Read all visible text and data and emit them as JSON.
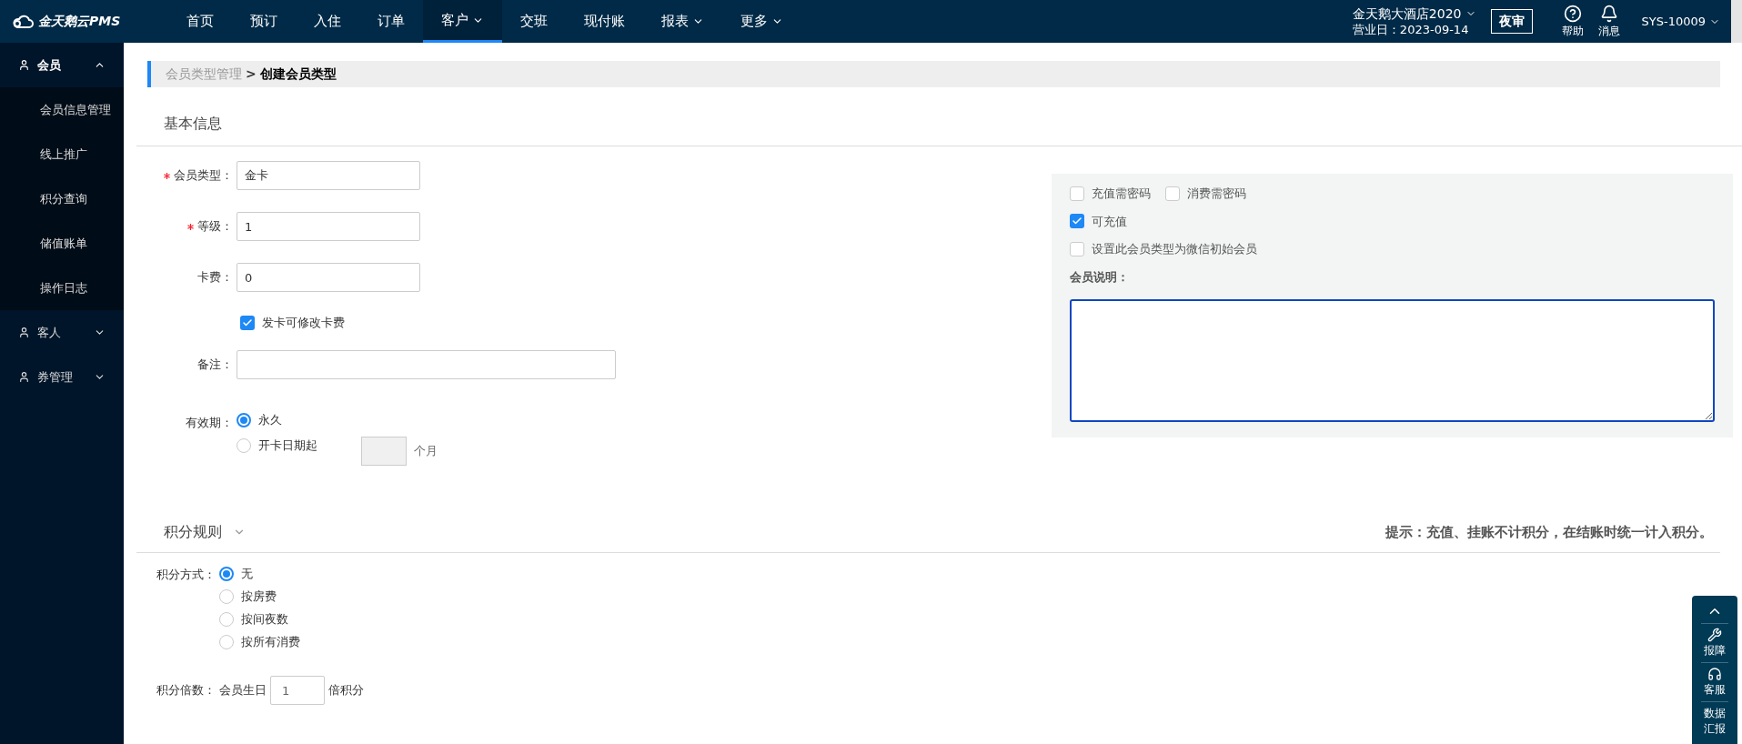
{
  "header": {
    "logo": "金天鹅云PMS",
    "nav": [
      {
        "label": "首页",
        "selected": false,
        "dropdown": false
      },
      {
        "label": "预订",
        "selected": false,
        "dropdown": false
      },
      {
        "label": "入住",
        "selected": false,
        "dropdown": false
      },
      {
        "label": "订单",
        "selected": false,
        "dropdown": false
      },
      {
        "label": "客户",
        "selected": true,
        "dropdown": true
      },
      {
        "label": "交班",
        "selected": false,
        "dropdown": false
      },
      {
        "label": "现付账",
        "selected": false,
        "dropdown": false
      },
      {
        "label": "报表",
        "selected": false,
        "dropdown": true
      },
      {
        "label": "更多",
        "selected": false,
        "dropdown": true
      }
    ],
    "hotel": "金天鹅大酒店2020",
    "business_date": "营业日：2023-09-14",
    "night_audit": "夜审",
    "help": "帮助",
    "messages": "消息",
    "user": "SYS-10009"
  },
  "sidebar": {
    "items": [
      {
        "label": "会员",
        "expanded": true,
        "children": [
          {
            "label": "会员信息管理"
          },
          {
            "label": "线上推广"
          },
          {
            "label": "积分查询"
          },
          {
            "label": "储值账单"
          },
          {
            "label": "操作日志"
          }
        ]
      },
      {
        "label": "客人",
        "expanded": false
      },
      {
        "label": "券管理",
        "expanded": false
      }
    ]
  },
  "breadcrumb": {
    "parent": "会员类型管理",
    "separator": ">",
    "current": "创建会员类型"
  },
  "basic_info": {
    "title": "基本信息",
    "fields": [
      {
        "kind": "input",
        "label": "会员类型：",
        "required": true,
        "value": "金卡"
      },
      {
        "kind": "input",
        "label": "等级：",
        "required": true,
        "value": "1"
      },
      {
        "kind": "input",
        "label": "卡费：",
        "required": false,
        "value": "0"
      },
      {
        "kind": "checkbox",
        "label": "发卡可修改卡费",
        "checked": true
      },
      {
        "kind": "wide_input",
        "label": "备注：",
        "required": false
      }
    ],
    "validity": {
      "label": "有效期：",
      "options": [
        {
          "label": "永久",
          "selected": true
        },
        {
          "label": "开卡日期起",
          "selected": false
        }
      ],
      "unit": "个月"
    },
    "options": [
      [
        {
          "label": "充值需密码",
          "checked": false
        },
        {
          "label": "消费需密码",
          "checked": false
        }
      ],
      [
        {
          "label": "可充值",
          "checked": true
        }
      ],
      [
        {
          "label": "设置此会员类型为微信初始会员",
          "checked": false
        }
      ]
    ],
    "description_label": "会员说明："
  },
  "points": {
    "title": "积分规则",
    "hint": "提示：充值、挂账不计积分，在结账时统一计入积分。",
    "method_label": "积分方式：",
    "methods": [
      {
        "label": "无",
        "selected": true
      },
      {
        "label": "按房费",
        "selected": false
      },
      {
        "label": "按间夜数",
        "selected": false
      },
      {
        "label": "按所有消费",
        "selected": false
      }
    ],
    "multiplier_label": "积分倍数：",
    "multiplier_prefix": "会员生日",
    "multiplier_value": "1",
    "multiplier_suffix": "倍积分"
  },
  "float_tools": [
    {
      "kind": "top"
    },
    {
      "kind": "repair",
      "label": "报障"
    },
    {
      "kind": "service",
      "label": "客服"
    },
    {
      "kind": "report",
      "label": "数据汇报"
    }
  ]
}
